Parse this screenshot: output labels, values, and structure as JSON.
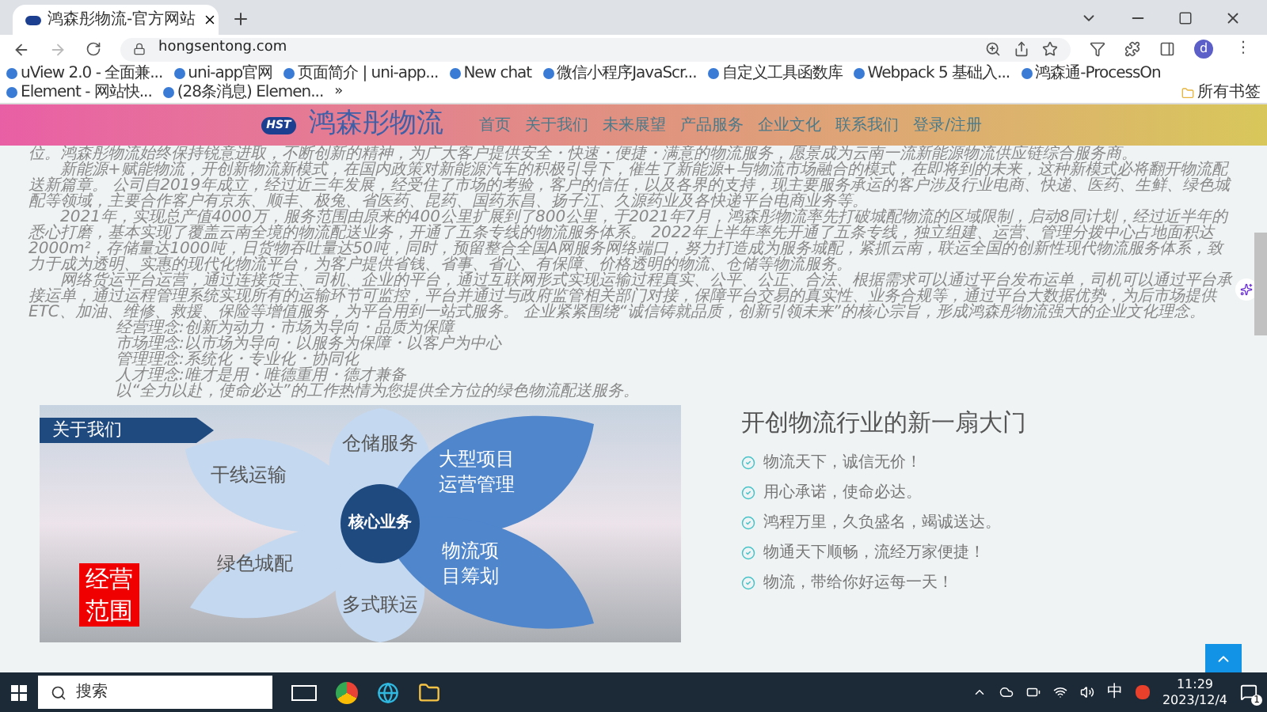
{
  "browser": {
    "tab_title": "鸿森彤物流-官方网站",
    "url": "hongsentong.com",
    "avatar": "d",
    "menu": "⋮",
    "bookmarks": [
      "uView 2.0 - 全面兼...",
      "uni-app官网",
      "页面简介 | uni-app...",
      "New chat",
      "微信小程序JavaScr...",
      "自定义工具函数库",
      "Webpack 5 基础入...",
      "鸿森通-ProcessOn",
      "Element - 网站快...",
      "(28条消息) Elemen..."
    ],
    "more": "»",
    "all_bookmarks": "所有书签"
  },
  "site_header": {
    "logo": "HST",
    "title": "鸿森彤物流",
    "nav": [
      "首页",
      "关于我们",
      "未来展望",
      "产品服务",
      "企业文化",
      "联系我们",
      "登录/注册"
    ]
  },
  "intro": {
    "paragraphs": [
      "位。鸿森彤物流始终保持锐意进取，不断创新的精神，为广大客户提供安全・快速・便捷・满意的物流服务，愿景成为云南一流新能源物流供应链综合服务商。",
      "新能源+赋能物流，开创新物流新模式，在国内政策对新能源汽车的积极引导下，催生了新能源+与物流市场融合的模式，在即将到的未来，这种新模式必将翻开物流配送新篇章。 公司自2019年成立，经过近三年发展，经受住了市场的考验，客户的信任，以及各界的支持，现主要服务承运的客户涉及行业电商、快递、医药、生鲜、绿色城配等领域，主要合作客户有京东、顺丰、极兔、省医药、昆药、国药东昌、扬子江、久源药业及各快递平台电商业务等。",
      "2021年，实现总产值4000万，服务范围由原来的400公里扩展到了800公里，于2021年7月，鸿森彤物流率先打破城配物流的区域限制，启动8同计划，经过近半年的悉心打磨，基本实现了覆盖云南全境的物流配送业务，开通了五条专线的物流服务体系。 2022年上半年率先开通了五条专线，独立组建、运营、管理分拨中心占地面积达2000m²，存储量达1000吨，日货物吞吐量达50吨，同时，预留整合全国A网服务网络端口，努力打造成为服务城配，紧抓云南，联运全国的创新性现代物流服务体系，致力于成为透明、实惠的现代化物流平台，为客户提供省钱、省事、省心、有保障、价格透明的物流、仓储等物流服务。",
      "网络货运平台运营，通过连接货主、司机、企业的平台，通过互联网形式实现运输过程真实、公平、公正、合法、根据需求可以通过平台发布运单，司机可以通过平台承接运单，通过运程管理系统实现所有的运输环节可监控，平台并通过与政府监管相关部门对接，保障平台交易的真实性、业务合规等，通过平台大数据优势，为后市场提供ETC、加油、维修、救援、保险等增值服务，为平台用到一站式服务。 企业紧紧围绕“诚信铸就品质，创新引领未来”的核心宗旨，形成鸿森彤物流强大的企业文化理念。"
    ],
    "concepts": [
      "经营理念:创新为动力・市场为导向・品质为保障",
      "市场理念:以市场为导向・以服务为保障・以客户为中心",
      "管理理念:系统化・专业化・协同化",
      "人才理念:唯才是用・唯德重用・德才兼备",
      "以“全力以赴，使命必达”的工作热情为您提供全方位的绿色物流配送服务。"
    ]
  },
  "about_graphic": {
    "banner": "关于我们",
    "center": "核心业务",
    "petals": [
      "仓储服务",
      "干线运输",
      "大型项目运营管理",
      "绿色城配",
      "物流项目筹划",
      "多式联运"
    ],
    "stamp": "经营范围"
  },
  "slogans": {
    "heading": "开创物流行业的新一扇大门",
    "items": [
      "物流天下，诚信无价！",
      "用心承诺，使命必达。",
      "鸿程万里，久负盛名，竭诚送达。",
      "物通天下顺畅，流经万家便捷！",
      "物流，带给你好运每一天！"
    ]
  },
  "taskbar": {
    "search": "搜索",
    "ime": "中",
    "time": "11:29",
    "date": "2023/12/4",
    "notifications": "1"
  }
}
